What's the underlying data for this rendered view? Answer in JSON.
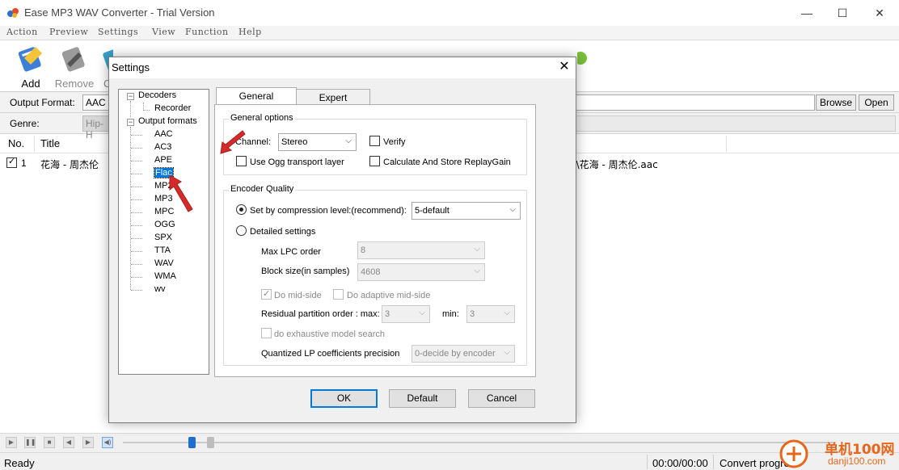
{
  "window": {
    "title": "Ease MP3 WAV Converter - Trial Version",
    "controls": {
      "minimize": "—",
      "maximize": "☐",
      "close": "✕"
    }
  },
  "menu": [
    "Action",
    "Preview",
    "Settings",
    "View",
    "Function",
    "Help"
  ],
  "toolbar": [
    {
      "label": "Add",
      "icon": "add-icon"
    },
    {
      "label": "Remove",
      "icon": "remove-icon"
    },
    {
      "label": "C",
      "icon": "clear-icon"
    }
  ],
  "output_row": {
    "label": "Output Format:",
    "value": "AAC",
    "browse": "Browse",
    "open": "Open"
  },
  "genre_row": {
    "label": "Genre:",
    "value": "Hip-H"
  },
  "file_list": {
    "columns": [
      "No.",
      "Title"
    ],
    "rows": [
      {
        "no": "1",
        "title": "花海 - 周杰伦",
        "path": "c\\花海 - 周杰伦.aac",
        "checked": true
      }
    ]
  },
  "status": {
    "ready": "Ready",
    "time": "00:00/00:00",
    "progress": "Convert progress"
  },
  "watermark": {
    "text1": "单机100网",
    "text2": "danji100.com"
  },
  "dialog": {
    "title": "Settings",
    "close": "✕",
    "tree": {
      "decoders": "Decoders",
      "recorder": "Recorder",
      "output_formats": "Output formats",
      "formats": [
        "AAC",
        "AC3",
        "APE",
        "Flac",
        "MP2",
        "MP3",
        "MPC",
        "OGG",
        "SPX",
        "TTA",
        "WAV",
        "WMA",
        "wv"
      ],
      "selected": "Flac"
    },
    "tabs": {
      "general": "General",
      "expert": "Expert"
    },
    "general_options": {
      "title": "General options",
      "channel_label": "Channel:",
      "channel_value": "Stereo",
      "verify": "Verify",
      "ogg_transport": "Use Ogg transport layer",
      "replaygain": "Calculate And Store ReplayGain"
    },
    "encoder_quality": {
      "title": "Encoder Quality",
      "compression_label": "Set by compression level:(recommend):",
      "compression_value": "5-default",
      "detailed": "Detailed settings",
      "max_lpc_label": "Max LPC order",
      "max_lpc_value": "8",
      "block_size_label": "Block size(in samples)",
      "block_size_value": "4608",
      "mid_side": "Do mid-side",
      "adaptive_mid_side": "Do adaptive mid-side",
      "residual_label": "Residual partition order : max:",
      "residual_max": "3",
      "min_label": "min:",
      "residual_min": "3",
      "exhaustive": "do exhaustive model search",
      "qlp_label": "Quantized LP coefficients precision",
      "qlp_value": "0-decide by encoder"
    },
    "buttons": {
      "ok": "OK",
      "default": "Default",
      "cancel": "Cancel"
    }
  },
  "colors": {
    "accent": "#0078d7",
    "arrow": "#d42a2a"
  }
}
